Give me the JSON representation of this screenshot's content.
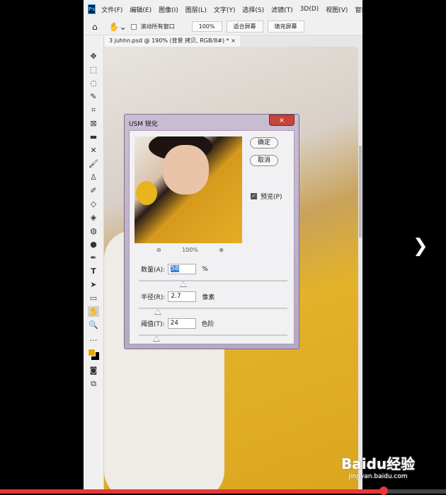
{
  "menubar": {
    "items": [
      "文件(F)",
      "编辑(E)",
      "图像(I)",
      "图层(L)",
      "文字(Y)",
      "选择(S)",
      "滤镜(T)",
      "3D(D)",
      "视图(V)",
      "窗口"
    ]
  },
  "options": {
    "scroll_all": "滚动所有窗口",
    "zoom": "100%",
    "fit_screen": "适合屏幕",
    "fill_screen": "填充屏幕"
  },
  "document_tab": {
    "title": "3 juhhn.psd @ 190% (背景 拷贝, RGB/8#) *",
    "close": "×"
  },
  "dialog": {
    "title": "USM 锐化",
    "close": "×",
    "ok": "确定",
    "cancel": "取消",
    "preview_label": "预览(P)",
    "preview_checked": true,
    "preview_zoom": "100%",
    "amount": {
      "label": "数量(A):",
      "value": "58",
      "unit": "%",
      "slider": 0.3
    },
    "radius": {
      "label": "半径(R):",
      "value": "2.7",
      "unit": "像素",
      "slider": 0.13
    },
    "threshold": {
      "label": "阈值(T):",
      "value": "24",
      "unit": "色阶",
      "slider": 0.12
    }
  },
  "colors": {
    "foreground": "#e8a800",
    "background": "#000000",
    "accent": "#e53935"
  },
  "video": {
    "progress": 0.86
  },
  "watermark": {
    "brand": "Baidu经验",
    "url": "jingyan.baidu.com"
  }
}
